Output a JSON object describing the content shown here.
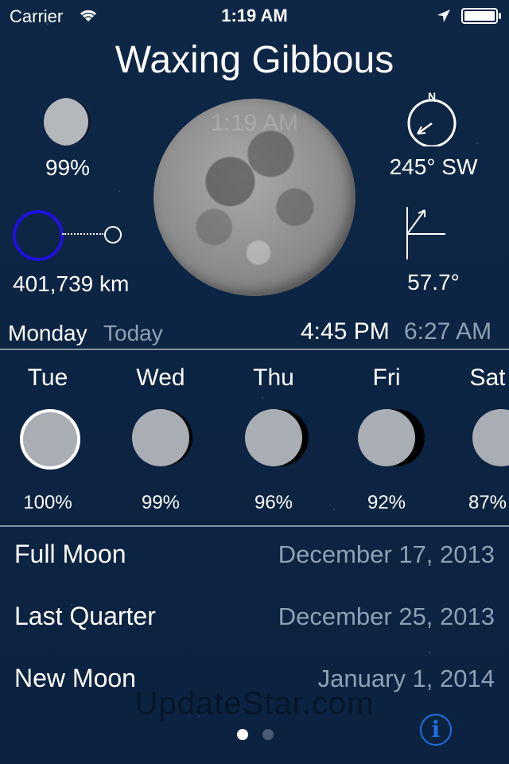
{
  "status_bar": {
    "carrier": "Carrier",
    "time": "1:19 AM",
    "icons": [
      "wifi-icon",
      "location-arrow-icon",
      "battery-icon"
    ]
  },
  "phase": {
    "title": "Waxing Gibbous"
  },
  "moon_overlay_time": "1:19 AM",
  "illumination": {
    "value": "99%"
  },
  "distance": {
    "value": "401,739 km"
  },
  "direction": {
    "value": "245° SW",
    "compass_label": "N"
  },
  "altitude": {
    "value": "57.7°"
  },
  "day": {
    "name": "Monday",
    "relative": "Today",
    "rise": "4:45 PM",
    "set": "6:27 AM"
  },
  "forecast": [
    {
      "day": "Tue",
      "percent": "100%",
      "illumination": 1.0
    },
    {
      "day": "Wed",
      "percent": "99%",
      "illumination": 0.99
    },
    {
      "day": "Thu",
      "percent": "96%",
      "illumination": 0.96
    },
    {
      "day": "Fri",
      "percent": "92%",
      "illumination": 0.92
    },
    {
      "day": "Sat",
      "percent": "87%",
      "illumination": 0.87
    }
  ],
  "events": [
    {
      "name": "Full Moon",
      "date": "December 17, 2013"
    },
    {
      "name": "Last Quarter",
      "date": "December 25, 2013"
    },
    {
      "name": "New Moon",
      "date": "January 1, 2014"
    }
  ],
  "watermark": "UpdateStar.com",
  "pagination": {
    "current": 1,
    "total": 2
  },
  "info_button": {
    "label": "i"
  },
  "colors": {
    "background": "#0c2340",
    "accent": "#1e6fe0",
    "earth_ring": "#1d10e0",
    "muted": "#8ea0b4"
  }
}
